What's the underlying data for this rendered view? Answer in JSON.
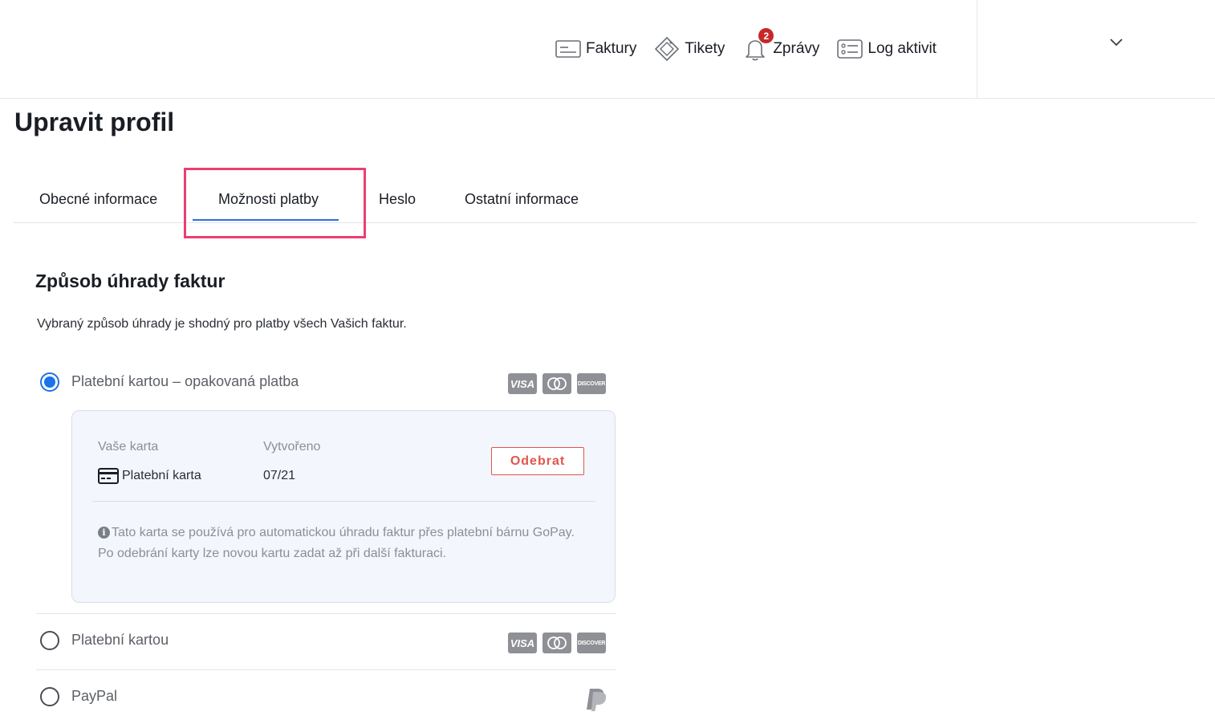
{
  "header": {
    "nav": [
      {
        "label": "Faktury",
        "icon": "invoice-icon"
      },
      {
        "label": "Tikety",
        "icon": "ticket-icon"
      },
      {
        "label": "Zprávy",
        "icon": "bell-icon",
        "badge": "2"
      },
      {
        "label": "Log aktivit",
        "icon": "activity-log-icon"
      }
    ],
    "user_menu_icon": "chevron-down-icon"
  },
  "page": {
    "title": "Upravit profil",
    "tabs": [
      {
        "label": "Obecné informace",
        "active": false
      },
      {
        "label": "Možnosti platby",
        "active": true
      },
      {
        "label": "Heslo",
        "active": false
      },
      {
        "label": "Ostatní informace",
        "active": false
      }
    ]
  },
  "section": {
    "title": "Způsob úhrady faktur",
    "description": "Vybraný způsob úhrady je shodný pro platby všech Vašich faktur."
  },
  "payment_options": [
    {
      "label": "Platební kartou – opakovaná platba",
      "selected": true,
      "logos": [
        "VISA",
        "mastercard",
        "DISCOVER"
      ]
    },
    {
      "label": "Platební kartou",
      "selected": false,
      "logos": [
        "VISA",
        "mastercard",
        "DISCOVER"
      ]
    },
    {
      "label": "PayPal",
      "selected": false,
      "logos": [
        "paypal"
      ]
    }
  ],
  "card_panel": {
    "card_label": "Vaše karta",
    "card_value": "Platební karta",
    "created_label": "Vytvořeno",
    "created_value": "07/21",
    "remove_label": "Odebrat",
    "info_text": "Tato karta se používá pro automatickou úhradu faktur přes platební bárnu GoPay. Po odebrání karty lze novou kartu zadat až při další fakturaci."
  },
  "colors": {
    "accent": "#1a73e8",
    "tab_underline": "#2f6fd6",
    "highlight": "#ec3e72",
    "danger": "#e0564a",
    "badge": "#c62828"
  }
}
